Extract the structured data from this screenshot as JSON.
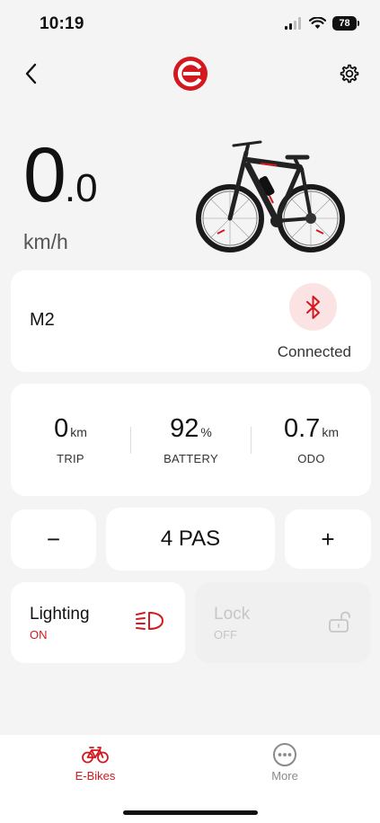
{
  "status_bar": {
    "time": "10:19",
    "battery": "78"
  },
  "header": {
    "back_icon": "chevron-left-icon",
    "logo_icon": "app-logo-icon",
    "settings_icon": "gear-icon"
  },
  "speed": {
    "integer": "0",
    "decimal": ".0",
    "unit": "km/h"
  },
  "device": {
    "name": "M2",
    "status": "Connected",
    "icon": "bluetooth-icon"
  },
  "stats": [
    {
      "value": "0",
      "unit": "km",
      "label": "TRIP"
    },
    {
      "value": "92",
      "unit": "%",
      "label": "BATTERY"
    },
    {
      "value": "0.7",
      "unit": "km",
      "label": "ODO"
    }
  ],
  "pas": {
    "minus": "−",
    "value": "4 PAS",
    "plus": "+"
  },
  "tiles": {
    "lighting": {
      "title": "Lighting",
      "state": "ON",
      "icon": "headlight-icon"
    },
    "lock": {
      "title": "Lock",
      "state": "OFF",
      "icon": "unlock-icon"
    }
  },
  "tabs": [
    {
      "label": "E-Bikes",
      "icon": "bicycle-icon",
      "active": true
    },
    {
      "label": "More",
      "icon": "more-icon",
      "active": false
    }
  ],
  "colors": {
    "accent": "#d3181f",
    "background": "#f4f4f4",
    "card": "#ffffff",
    "disabled": "#c6c6c6"
  }
}
